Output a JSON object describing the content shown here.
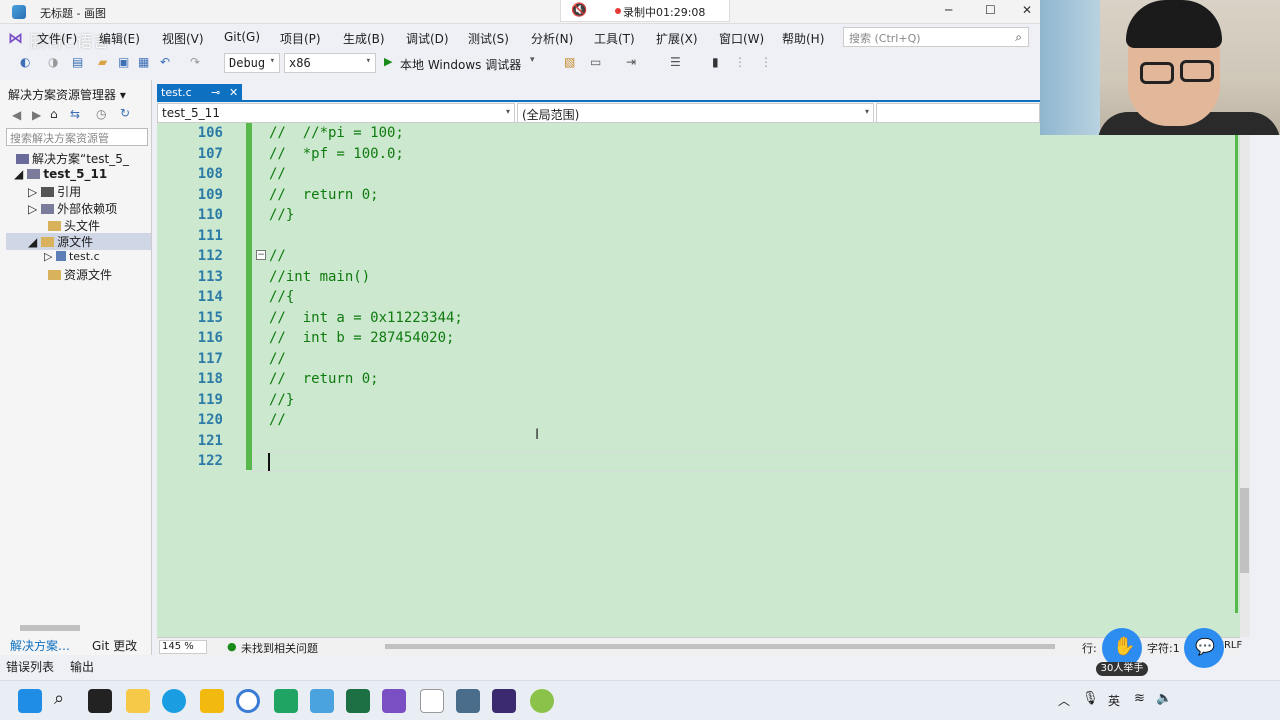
{
  "paint": {
    "title": "无标题 - 画图",
    "recording": "录制中01:29:08"
  },
  "watermark": "鹏哥C语言",
  "menu": [
    "文件(F)",
    "编辑(E)",
    "视图(V)",
    "Git(G)",
    "项目(P)",
    "生成(B)",
    "调试(D)",
    "测试(S)",
    "分析(N)",
    "工具(T)",
    "扩展(X)",
    "窗口(W)",
    "帮助(H)"
  ],
  "search_placeholder": "搜索 (Ctrl+Q)",
  "toolbar": {
    "config": "Debug",
    "platform": "x86",
    "run": "本地 Windows 调试器"
  },
  "solution_explorer": {
    "title": "解决方案资源管理器",
    "search": "搜索解决方案资源管",
    "solution": "解决方案“test_5_",
    "project": "test_5_11",
    "items": [
      "引用",
      "外部依赖项",
      "头文件",
      "源文件",
      "test.c",
      "资源文件"
    ],
    "tabs": [
      "解决方案…",
      "Git 更改"
    ]
  },
  "editor": {
    "tab": "test.c",
    "nav_project": "test_5_11",
    "nav_scope": "(全局范围)",
    "lines": [
      {
        "n": "106",
        "t": "//  //*pi = 100;"
      },
      {
        "n": "107",
        "t": "//  *pf = 100.0;"
      },
      {
        "n": "108",
        "t": "//"
      },
      {
        "n": "109",
        "t": "//  return 0;"
      },
      {
        "n": "110",
        "t": "//}"
      },
      {
        "n": "111",
        "t": ""
      },
      {
        "n": "112",
        "t": "//"
      },
      {
        "n": "113",
        "t": "//int main()"
      },
      {
        "n": "114",
        "t": "//{"
      },
      {
        "n": "115",
        "t": "//  int a = 0x11223344;"
      },
      {
        "n": "116",
        "t": "//  int b = 287454020;"
      },
      {
        "n": "117",
        "t": "//"
      },
      {
        "n": "118",
        "t": "//  return 0;"
      },
      {
        "n": "119",
        "t": "//}"
      },
      {
        "n": "120",
        "t": "//"
      },
      {
        "n": "121",
        "t": ""
      },
      {
        "n": "122",
        "t": ""
      }
    ]
  },
  "status": {
    "zoom": "145 %",
    "issues": "未找到相关问题",
    "line": "行:",
    "col": "字符:1",
    "eol": "CRLF"
  },
  "bottom_tabs": [
    "错误列表",
    "输出"
  ],
  "raise_hand": "30人举手",
  "tray": {
    "ime": "英"
  },
  "colors": {
    "editor_bg": "#cce8cf",
    "comment": "#0f7b0f",
    "line_number": "#2b7ba6",
    "accent": "#0e70c0"
  }
}
